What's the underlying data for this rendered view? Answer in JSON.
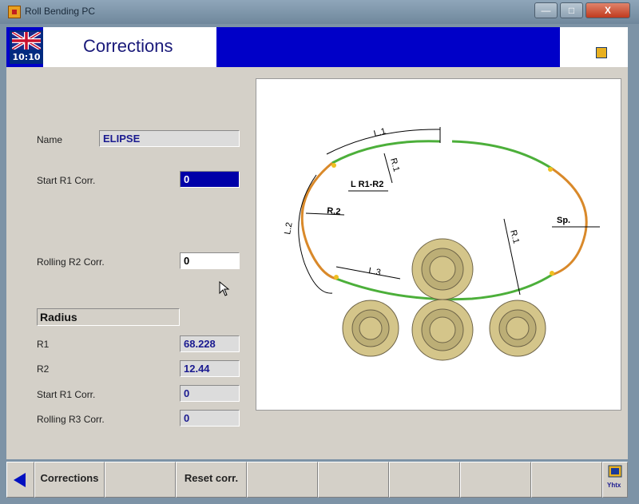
{
  "window": {
    "title": "Roll Bending PC",
    "min": "—",
    "max": "□",
    "close": "X"
  },
  "header": {
    "time": "10:10",
    "title": "Corrections"
  },
  "form": {
    "name_label": "Name",
    "name_value": "ELIPSE",
    "start_r1_label": "Start R1 Corr.",
    "start_r1_value": "0",
    "rolling_r2_label": "Rolling R2 Corr.",
    "rolling_r2_value": "0"
  },
  "radius": {
    "title": "Radius",
    "r1_label": "R1",
    "r1_value": "68.228",
    "r2_label": "R2",
    "r2_value": "12.44",
    "start_r1_label": "Start R1 Corr.",
    "start_r1_value": "0",
    "rolling_r3_label": "Rolling R3 Corr.",
    "rolling_r3_value": "0"
  },
  "diagram": {
    "labels": {
      "l1": "L.1",
      "l2": "L.2",
      "l3": "L.3",
      "r1_top": "R.1",
      "r1_right": "R.1",
      "r2": "R.2",
      "lr1r2": "L R1-R2",
      "sp": "Sp."
    },
    "colors": {
      "straight": "#4caf3a",
      "arc": "#d9892a",
      "roller": "#d4c58a",
      "roller_stroke": "#6e6448"
    }
  },
  "toolbar": {
    "corrections_label": "Corrections",
    "reset_label": "Reset corr.",
    "help_label": "Yhtx"
  }
}
